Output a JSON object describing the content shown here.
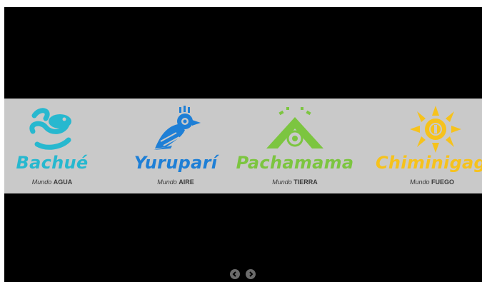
{
  "slides": [
    {
      "name": "Bachué",
      "mundo": "Mundo",
      "element": "AGUA",
      "color": "#27b8cf",
      "icon": "fish-water-icon"
    },
    {
      "name": "Yuruparí",
      "mundo": "Mundo",
      "element": "AIRE",
      "color": "#1e7fd6",
      "icon": "bird-icon"
    },
    {
      "name": "Pachamama",
      "mundo": "Mundo",
      "element": "TIERRA",
      "color": "#7cc540",
      "icon": "mountain-icon"
    },
    {
      "name": "Chiminigagua",
      "mundo": "Mundo",
      "element": "FUEGO",
      "color": "#f6c21c",
      "icon": "sun-icon"
    }
  ],
  "nav": {
    "prev_icon": "arrow-left-icon",
    "next_icon": "arrow-right-icon"
  },
  "colors": {
    "background": "#000000",
    "strip": "#c9c9c9",
    "nav_button": "#6b6b6b"
  }
}
